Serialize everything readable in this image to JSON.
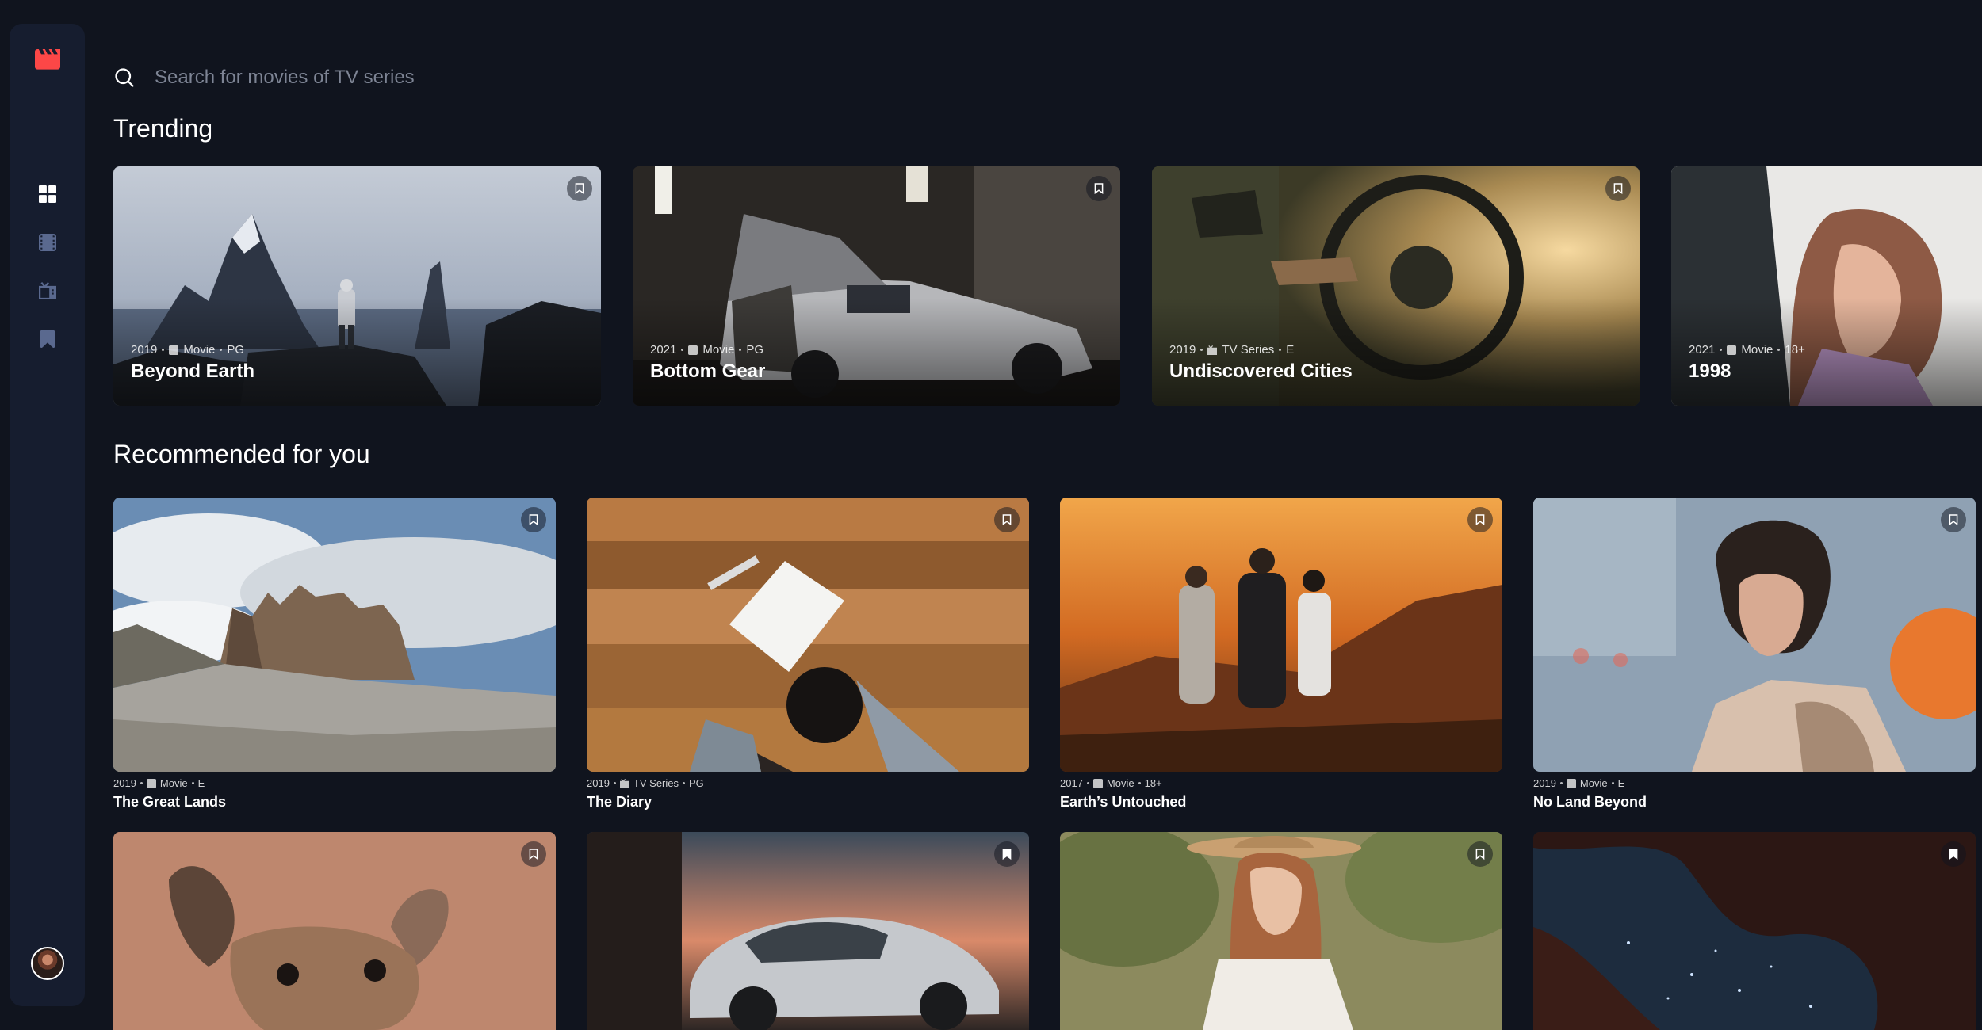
{
  "search": {
    "placeholder": "Search for movies of TV series"
  },
  "sections": {
    "trending": "Trending",
    "recommended": "Recommended for you"
  },
  "nav": [
    "home-grid-icon",
    "movies-icon",
    "tv-series-icon",
    "bookmark-icon"
  ],
  "colors": {
    "accent": "#fc4747",
    "background": "#10141e",
    "sidebar": "#161d2f",
    "nav_inactive": "#5a698f",
    "text_muted": "#7d8494"
  },
  "trending": [
    {
      "year": "2019",
      "category": "Movie",
      "rating": "PG",
      "title": "Beyond Earth"
    },
    {
      "year": "2021",
      "category": "Movie",
      "rating": "PG",
      "title": "Bottom Gear"
    },
    {
      "year": "2019",
      "category": "TV Series",
      "rating": "E",
      "title": "Undiscovered Cities"
    },
    {
      "year": "2021",
      "category": "Movie",
      "rating": "18+",
      "title": "1998"
    }
  ],
  "recommended": [
    {
      "year": "2019",
      "category": "Movie",
      "rating": "E",
      "title": "The Great Lands"
    },
    {
      "year": "2019",
      "category": "TV Series",
      "rating": "PG",
      "title": "The Diary"
    },
    {
      "year": "2017",
      "category": "Movie",
      "rating": "18+",
      "title": "Earth’s Untouched"
    },
    {
      "year": "2019",
      "category": "Movie",
      "rating": "E",
      "title": "No Land Beyond"
    }
  ]
}
